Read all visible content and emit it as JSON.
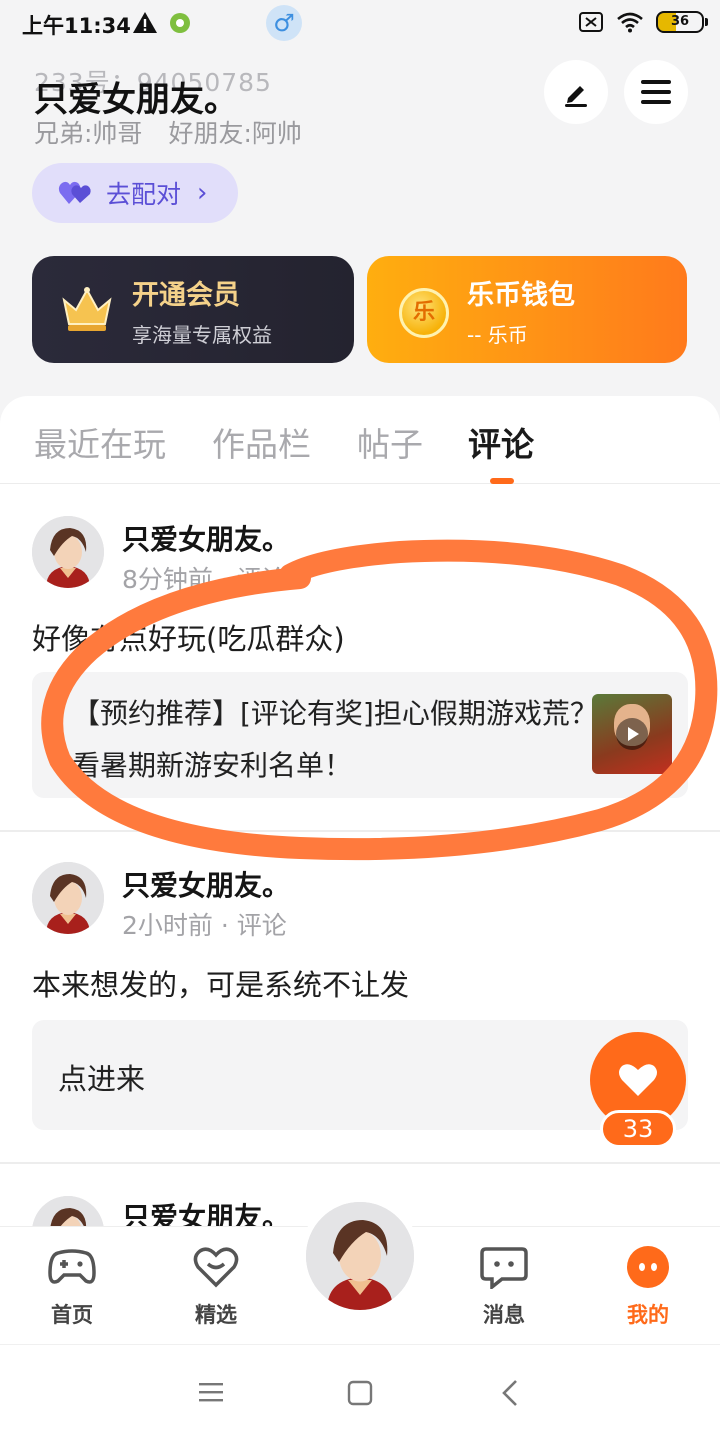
{
  "status_bar": {
    "time": "上午11:34",
    "battery": "36"
  },
  "profile": {
    "gender_symbol": "♂",
    "id_text": "233号：94050785",
    "name": "只爱女朋友。",
    "relations": [
      "兄弟:帅哥",
      "好朋友:阿帅"
    ],
    "match_label": "去配对"
  },
  "cards": {
    "vip": {
      "title": "开通会员",
      "subtitle": "享海量专属权益"
    },
    "wallet": {
      "title": "乐币钱包",
      "subtitle": "-- 乐币",
      "coin_glyph": "乐"
    }
  },
  "tabs": [
    {
      "label": "最近在玩"
    },
    {
      "label": "作品栏"
    },
    {
      "label": "帖子"
    },
    {
      "label": "评论",
      "active": true
    }
  ],
  "posts": [
    {
      "author": "只爱女朋友。",
      "meta": "8分钟前 · 评论",
      "text": "好像有点好玩(吃瓜群众)",
      "quote": "【预约推荐】[评论有奖]担心假期游戏荒？来看暑期新游安利名单！"
    },
    {
      "author": "只爱女朋友。",
      "meta": "2小时前 · 评论",
      "text": "本来想发的，可是系统不让发",
      "quote": "点进来"
    },
    {
      "author": "只爱女朋友。"
    }
  ],
  "like": {
    "count": "33"
  },
  "bottom_nav": [
    {
      "label": "首页"
    },
    {
      "label": "精选"
    },
    {
      "label": "消息"
    },
    {
      "label": "我的",
      "active": true
    }
  ],
  "colors": {
    "accent": "#ff6a1a",
    "match_bg": "#e1defa",
    "match_text": "#5b4fd6",
    "vip_bg": "#2b2a3a",
    "wallet_bg": "#ff8c15",
    "annotation_stroke": "#ff7a3d"
  }
}
